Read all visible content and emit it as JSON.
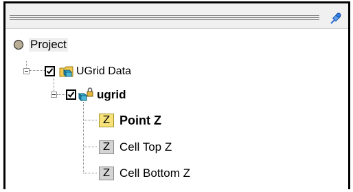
{
  "tree": {
    "project": {
      "label": "Project"
    },
    "ugrid_data": {
      "label": "UGrid Data",
      "checked": true
    },
    "ugrid": {
      "label": "ugrid",
      "checked": true
    },
    "datasets": [
      {
        "label": "Point Z",
        "active": true,
        "icon_letter": "Z"
      },
      {
        "label": "Cell Top Z",
        "active": false,
        "icon_letter": "Z"
      },
      {
        "label": "Cell Bottom Z",
        "active": false,
        "icon_letter": "Z"
      }
    ]
  },
  "toolbar": {
    "pin_icon": "pin-icon"
  }
}
